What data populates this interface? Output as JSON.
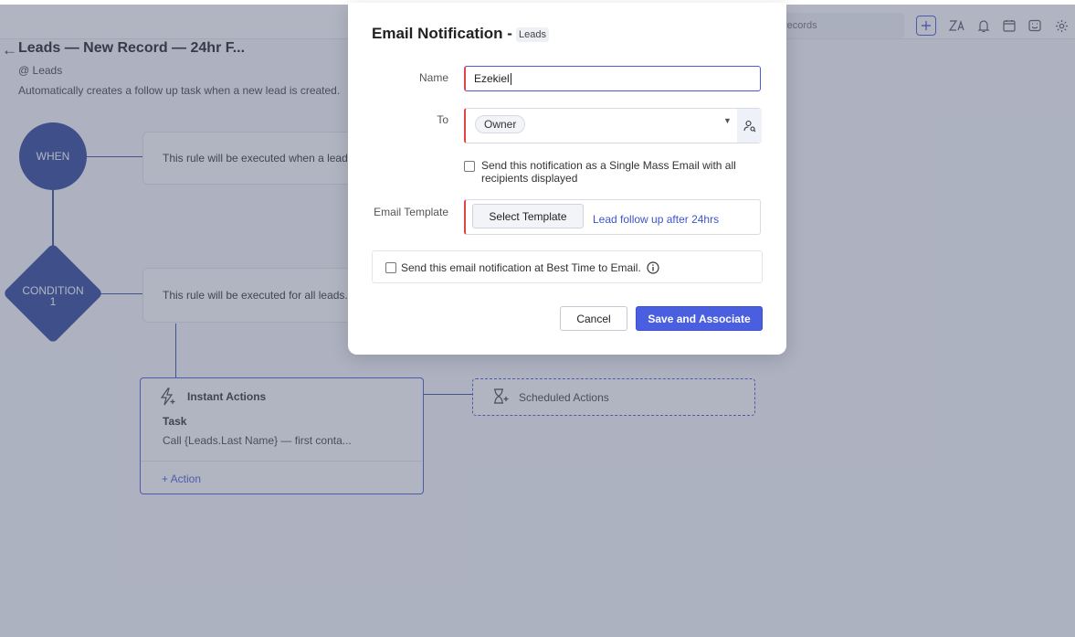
{
  "topbar": {
    "search_placeholder": "records"
  },
  "rule": {
    "back_icon": "←",
    "title": "Leads — New Record — 24hr F...",
    "module": "@ Leads",
    "description": "Automatically creates a follow up task when a new lead is created.",
    "when_label": "WHEN",
    "when_text": "This rule will be executed when a lead",
    "condition_label": "CONDITION",
    "condition_number": "1",
    "condition_text": "This rule will be executed for all leads."
  },
  "instant_actions": {
    "title": "Instant Actions",
    "task_label": "Task",
    "task_desc": "Call {Leads.Last Name} — first conta...",
    "add_action": "+ Action"
  },
  "scheduled_actions": {
    "title": "Scheduled Actions"
  },
  "modal": {
    "title": "Email Notification -",
    "module_badge": "Leads",
    "name_label": "Name",
    "name_value": "Ezekiel",
    "to_label": "To",
    "to_chip": "Owner",
    "mass_email_label": "Send this notification as a Single Mass Email with all recipients displayed",
    "template_label": "Email Template",
    "select_template_button": "Select Template",
    "selected_template": "Lead follow up after 24hrs",
    "best_time_label": "Send this email notification at Best Time to Email.",
    "cancel_button": "Cancel",
    "save_button": "Save and Associate"
  },
  "colors": {
    "accent": "#4a5ee0",
    "node_fill": "#2f4699",
    "required_marker": "#e0453f",
    "link": "#3d55c8"
  },
  "icons": [
    "back-arrow-icon",
    "plus-icon",
    "translate-icon",
    "bell-icon",
    "calendar-icon",
    "feedback-icon",
    "gear-icon",
    "instant-action-icon",
    "scheduled-action-icon",
    "user-lookup-icon",
    "dropdown-caret-icon",
    "info-icon"
  ]
}
